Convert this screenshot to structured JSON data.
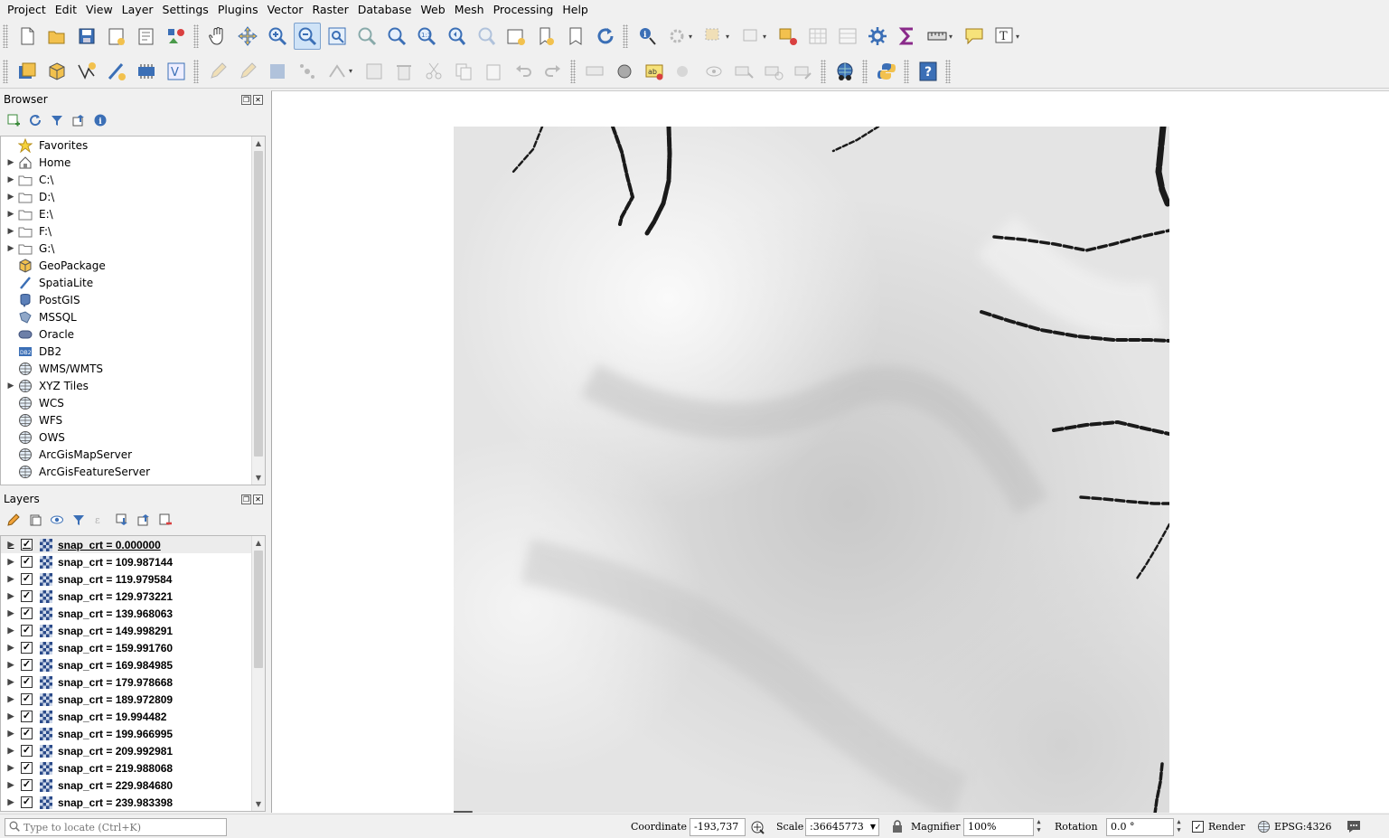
{
  "menu": [
    "Project",
    "Edit",
    "View",
    "Layer",
    "Settings",
    "Plugins",
    "Vector",
    "Raster",
    "Database",
    "Web",
    "Mesh",
    "Processing",
    "Help"
  ],
  "browser": {
    "title": "Browser",
    "items": [
      {
        "label": "Favorites",
        "icon": "star-icon",
        "expandable": false
      },
      {
        "label": "Home",
        "icon": "home-icon",
        "expandable": true
      },
      {
        "label": "C:\\",
        "icon": "folder-icon",
        "expandable": true
      },
      {
        "label": "D:\\",
        "icon": "folder-icon",
        "expandable": true
      },
      {
        "label": "E:\\",
        "icon": "folder-icon",
        "expandable": true
      },
      {
        "label": "F:\\",
        "icon": "folder-icon",
        "expandable": true
      },
      {
        "label": "G:\\",
        "icon": "folder-icon",
        "expandable": true
      },
      {
        "label": "GeoPackage",
        "icon": "geopackage-icon",
        "expandable": false
      },
      {
        "label": "SpatiaLite",
        "icon": "spatialite-icon",
        "expandable": false
      },
      {
        "label": "PostGIS",
        "icon": "postgis-icon",
        "expandable": false
      },
      {
        "label": "MSSQL",
        "icon": "mssql-icon",
        "expandable": false
      },
      {
        "label": "Oracle",
        "icon": "oracle-icon",
        "expandable": false
      },
      {
        "label": "DB2",
        "icon": "db2-icon",
        "expandable": false
      },
      {
        "label": "WMS/WMTS",
        "icon": "globe-icon",
        "expandable": false
      },
      {
        "label": "XYZ Tiles",
        "icon": "globe-icon",
        "expandable": true
      },
      {
        "label": "WCS",
        "icon": "globe-icon",
        "expandable": false
      },
      {
        "label": "WFS",
        "icon": "globe-icon",
        "expandable": false
      },
      {
        "label": "OWS",
        "icon": "globe-icon",
        "expandable": false
      },
      {
        "label": "ArcGisMapServer",
        "icon": "globe-icon",
        "expandable": false
      },
      {
        "label": "ArcGisFeatureServer",
        "icon": "globe-icon",
        "expandable": false
      }
    ]
  },
  "layers": {
    "title": "Layers",
    "items": [
      "snap_crt = 0.000000",
      "snap_crt = 109.987144",
      "snap_crt = 119.979584",
      "snap_crt = 129.973221",
      "snap_crt = 139.968063",
      "snap_crt = 149.998291",
      "snap_crt = 159.991760",
      "snap_crt = 169.984985",
      "snap_crt = 179.978668",
      "snap_crt = 189.972809",
      "snap_crt = 19.994482",
      "snap_crt = 199.966995",
      "snap_crt = 209.992981",
      "snap_crt = 219.988068",
      "snap_crt = 229.984680",
      "snap_crt = 239.983398"
    ]
  },
  "statusbar": {
    "locator_placeholder": "Type to locate (Ctrl+K)",
    "coordinate_label": "Coordinate",
    "coordinate_value": "-193,737",
    "scale_label": "Scale",
    "scale_value": ":36645773",
    "magnifier_label": "Magnifier",
    "magnifier_value": "100%",
    "rotation_label": "Rotation",
    "rotation_value": "0.0 °",
    "render_label": "Render",
    "crs": "EPSG:4326"
  },
  "colors": {
    "accent": "#7da2ce",
    "panel_bg": "#f0f0f0",
    "raster_light": "#f5f5f5",
    "raster_dark": "#c8c8c8",
    "contour": "#1a1a1a"
  }
}
